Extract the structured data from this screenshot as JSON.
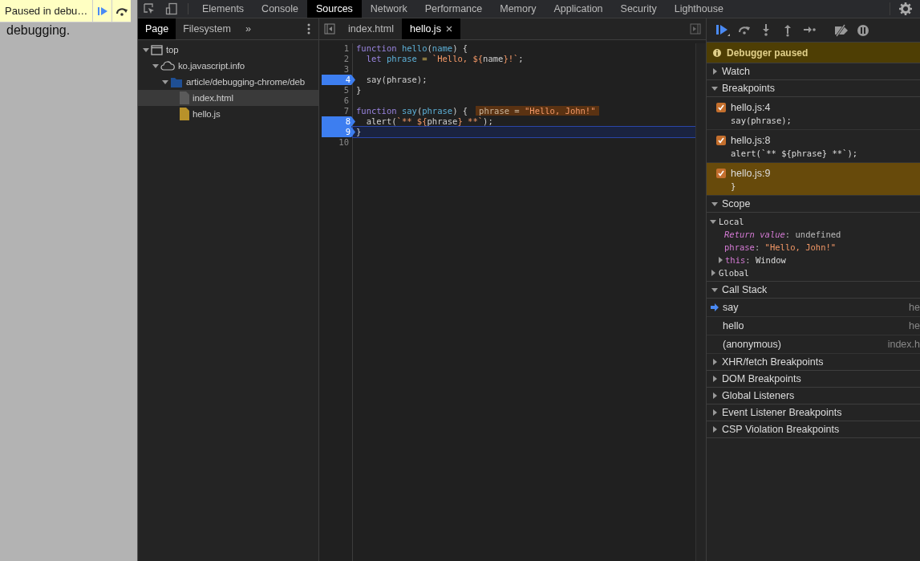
{
  "page_preview": {
    "text": "debugging.",
    "paused_banner": {
      "label": "Paused in debu…"
    }
  },
  "main_tabs": [
    {
      "label": "Elements",
      "selected": false
    },
    {
      "label": "Console",
      "selected": false
    },
    {
      "label": "Sources",
      "selected": true
    },
    {
      "label": "Network",
      "selected": false
    },
    {
      "label": "Performance",
      "selected": false
    },
    {
      "label": "Memory",
      "selected": false
    },
    {
      "label": "Application",
      "selected": false
    },
    {
      "label": "Security",
      "selected": false
    },
    {
      "label": "Lighthouse",
      "selected": false
    }
  ],
  "navigator": {
    "tabs": [
      {
        "label": "Page",
        "selected": true
      },
      {
        "label": "Filesystem",
        "selected": false
      }
    ],
    "more": "»",
    "tree": [
      {
        "label": "top",
        "kind": "frame",
        "expanded": true,
        "selected": false,
        "children": [
          {
            "label": "ko.javascript.info",
            "kind": "domain",
            "expanded": true,
            "selected": false,
            "children": [
              {
                "label": "article/debugging-chrome/deb",
                "kind": "folder",
                "expanded": true,
                "selected": false,
                "children": [
                  {
                    "label": "index.html",
                    "kind": "file",
                    "color": "#5a5a5a",
                    "selected": true
                  },
                  {
                    "label": "hello.js",
                    "kind": "file",
                    "color": "#b8922a",
                    "selected": false
                  }
                ]
              }
            ]
          }
        ]
      }
    ]
  },
  "editor": {
    "tabs": [
      {
        "label": "index.html",
        "selected": false,
        "closable": false
      },
      {
        "label": "hello.js",
        "selected": true,
        "closable": true
      }
    ],
    "lines": [
      {
        "number": "1",
        "breakpoint": false,
        "current": false,
        "tokens": [
          {
            "kind": "keyword",
            "text": "function"
          },
          {
            "kind": "name",
            "text": " hello"
          },
          {
            "kind": "plain",
            "text": "("
          },
          {
            "kind": "name",
            "text": "name"
          },
          {
            "kind": "plain",
            "text": ") {"
          }
        ]
      },
      {
        "number": "2",
        "breakpoint": false,
        "current": false,
        "tokens": [
          {
            "kind": "keyword",
            "text": "  let"
          },
          {
            "kind": "name",
            "text": " phrase"
          },
          {
            "kind": "operator",
            "text": " ="
          },
          {
            "kind": "string",
            "text": " `Hello, ${"
          },
          {
            "kind": "plain",
            "text": "name"
          },
          {
            "kind": "string",
            "text": "}!`"
          },
          {
            "kind": "plain",
            "text": ";"
          }
        ]
      },
      {
        "number": "3",
        "breakpoint": false,
        "current": false
      },
      {
        "number": "4",
        "breakpoint": true,
        "current": false,
        "tokens": [
          {
            "kind": "plain",
            "text": "  say(phrase);"
          }
        ]
      },
      {
        "number": "5",
        "breakpoint": false,
        "current": false,
        "tokens": [
          {
            "kind": "plain",
            "text": "}"
          }
        ]
      },
      {
        "number": "6",
        "breakpoint": false,
        "current": false
      },
      {
        "number": "7",
        "breakpoint": false,
        "current": false,
        "tokens": [
          {
            "kind": "keyword",
            "text": "function"
          },
          {
            "kind": "name",
            "text": " say"
          },
          {
            "kind": "plain",
            "text": "("
          },
          {
            "kind": "name",
            "text": "phrase"
          },
          {
            "kind": "plain",
            "text": ") {"
          }
        ],
        "inline_value": {
          "name": "phrase",
          "operator": "=",
          "value": "\"Hello, John!\""
        }
      },
      {
        "number": "8",
        "breakpoint": true,
        "current": false,
        "tokens": [
          {
            "kind": "plain",
            "text": "  alert("
          },
          {
            "kind": "string",
            "text": "`** ${"
          },
          {
            "kind": "plain",
            "text": "phrase"
          },
          {
            "kind": "string",
            "text": "} **`"
          },
          {
            "kind": "plain",
            "text": ");"
          }
        ]
      },
      {
        "number": "9",
        "breakpoint": true,
        "current": true,
        "tokens": [
          {
            "kind": "plain",
            "text": "}"
          }
        ]
      },
      {
        "number": "10",
        "breakpoint": false,
        "current": false
      }
    ]
  },
  "debugger": {
    "paused_message": "Debugger paused",
    "sections": [
      {
        "kind": "watch",
        "title": "Watch",
        "expanded": false
      },
      {
        "kind": "breakpoints",
        "title": "Breakpoints",
        "expanded": true,
        "items": [
          {
            "location": "hello.js:4",
            "code": "say(phrase);",
            "checked": true,
            "selected": false
          },
          {
            "location": "hello.js:8",
            "code": "alert(`** ${phrase} **`);",
            "checked": true,
            "selected": false
          },
          {
            "location": "hello.js:9",
            "code": "}",
            "checked": true,
            "selected": true
          }
        ]
      },
      {
        "kind": "scope",
        "title": "Scope",
        "expanded": true,
        "scopes": [
          {
            "title": "Local",
            "expanded": true,
            "properties": [
              {
                "name": "Return value",
                "separator": ":",
                "value": "undefined",
                "kind": "synthetic"
              },
              {
                "name": "phrase",
                "separator": ":",
                "value": "\"Hello, John!\"",
                "kind": "string"
              },
              {
                "name": "this",
                "separator": ":",
                "value": "Window",
                "kind": "object",
                "expanded": false
              }
            ]
          },
          {
            "title": "Global",
            "expanded": false
          }
        ]
      },
      {
        "kind": "callstack",
        "title": "Call Stack",
        "expanded": true,
        "frames": [
          {
            "name": "say",
            "location": "he",
            "selected": true
          },
          {
            "name": "hello",
            "location": "he",
            "selected": false
          },
          {
            "name": "(anonymous)",
            "location": "index.h",
            "selected": false
          }
        ]
      },
      {
        "kind": "plain",
        "title": "XHR/fetch Breakpoints",
        "expanded": false
      },
      {
        "kind": "plain",
        "title": "DOM Breakpoints",
        "expanded": false
      },
      {
        "kind": "plain",
        "title": "Global Listeners",
        "expanded": false
      },
      {
        "kind": "plain",
        "title": "Event Listener Breakpoints",
        "expanded": false
      },
      {
        "kind": "plain",
        "title": "CSP Violation Breakpoints",
        "expanded": false
      }
    ]
  }
}
